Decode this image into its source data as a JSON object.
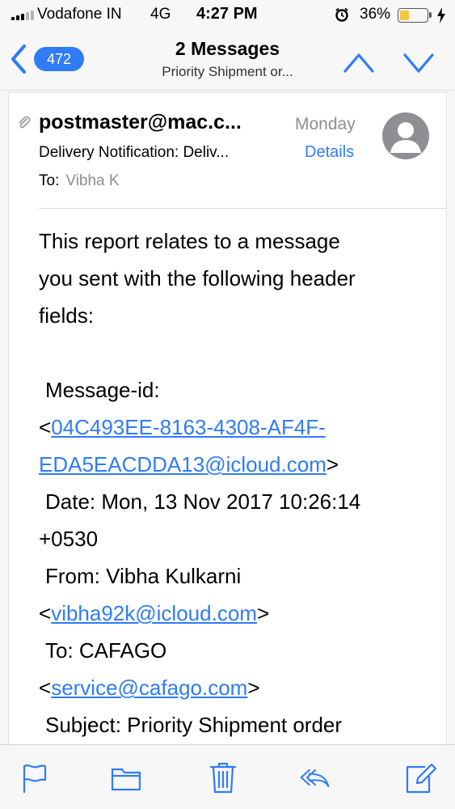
{
  "status_bar": {
    "carrier": "Vodafone IN",
    "network": "4G",
    "time": "4:27 PM",
    "battery_percent": "36%",
    "battery_level": 0.36,
    "icons": [
      "signal-icon",
      "alarm-icon",
      "battery-icon",
      "charging-icon"
    ]
  },
  "nav": {
    "back_count": "472",
    "title": "2 Messages",
    "subtitle": "Priority Shipment or...",
    "icons": [
      "back-chevron-icon",
      "chevron-up-icon",
      "chevron-down-icon"
    ]
  },
  "message": {
    "sender": "postmaster@mac.c...",
    "date": "Monday",
    "subject": "Delivery Notification: Deliv...",
    "details_label": "Details",
    "to_label": "To:",
    "to_value": "Vibha K",
    "body": {
      "intro_1": "This report relates to a message",
      "intro_2": "you sent with the following header",
      "intro_3": "fields:",
      "msgid_label": "Message-id:",
      "lt_1": "<",
      "msgid_1": "04C493EE-8163-4308-AF4F-",
      "msgid_2": "EDA5EACDDA13@icloud.com",
      "gt_1": ">",
      "date_1": "Date: Mon, 13 Nov 2017 10:26:14",
      "date_2": "+0530",
      "from_label": "From: Vibha Kulkarni",
      "lt_2": "<",
      "from_email": "vibha92k@icloud.com",
      "gt_2": ">",
      "to_label": "To: CAFAGO",
      "lt_3": "<",
      "to_email": "service@cafago.com",
      "gt_3": ">",
      "subject_label": "Subject: Priority Shipment order"
    }
  },
  "toolbar": {
    "icons": [
      "flag-icon",
      "folder-icon",
      "trash-icon",
      "reply-icon",
      "compose-icon"
    ]
  },
  "colors": {
    "accent": "#2f7cf6",
    "secondary_text": "#8e8e93",
    "battery": "#f5c542"
  }
}
